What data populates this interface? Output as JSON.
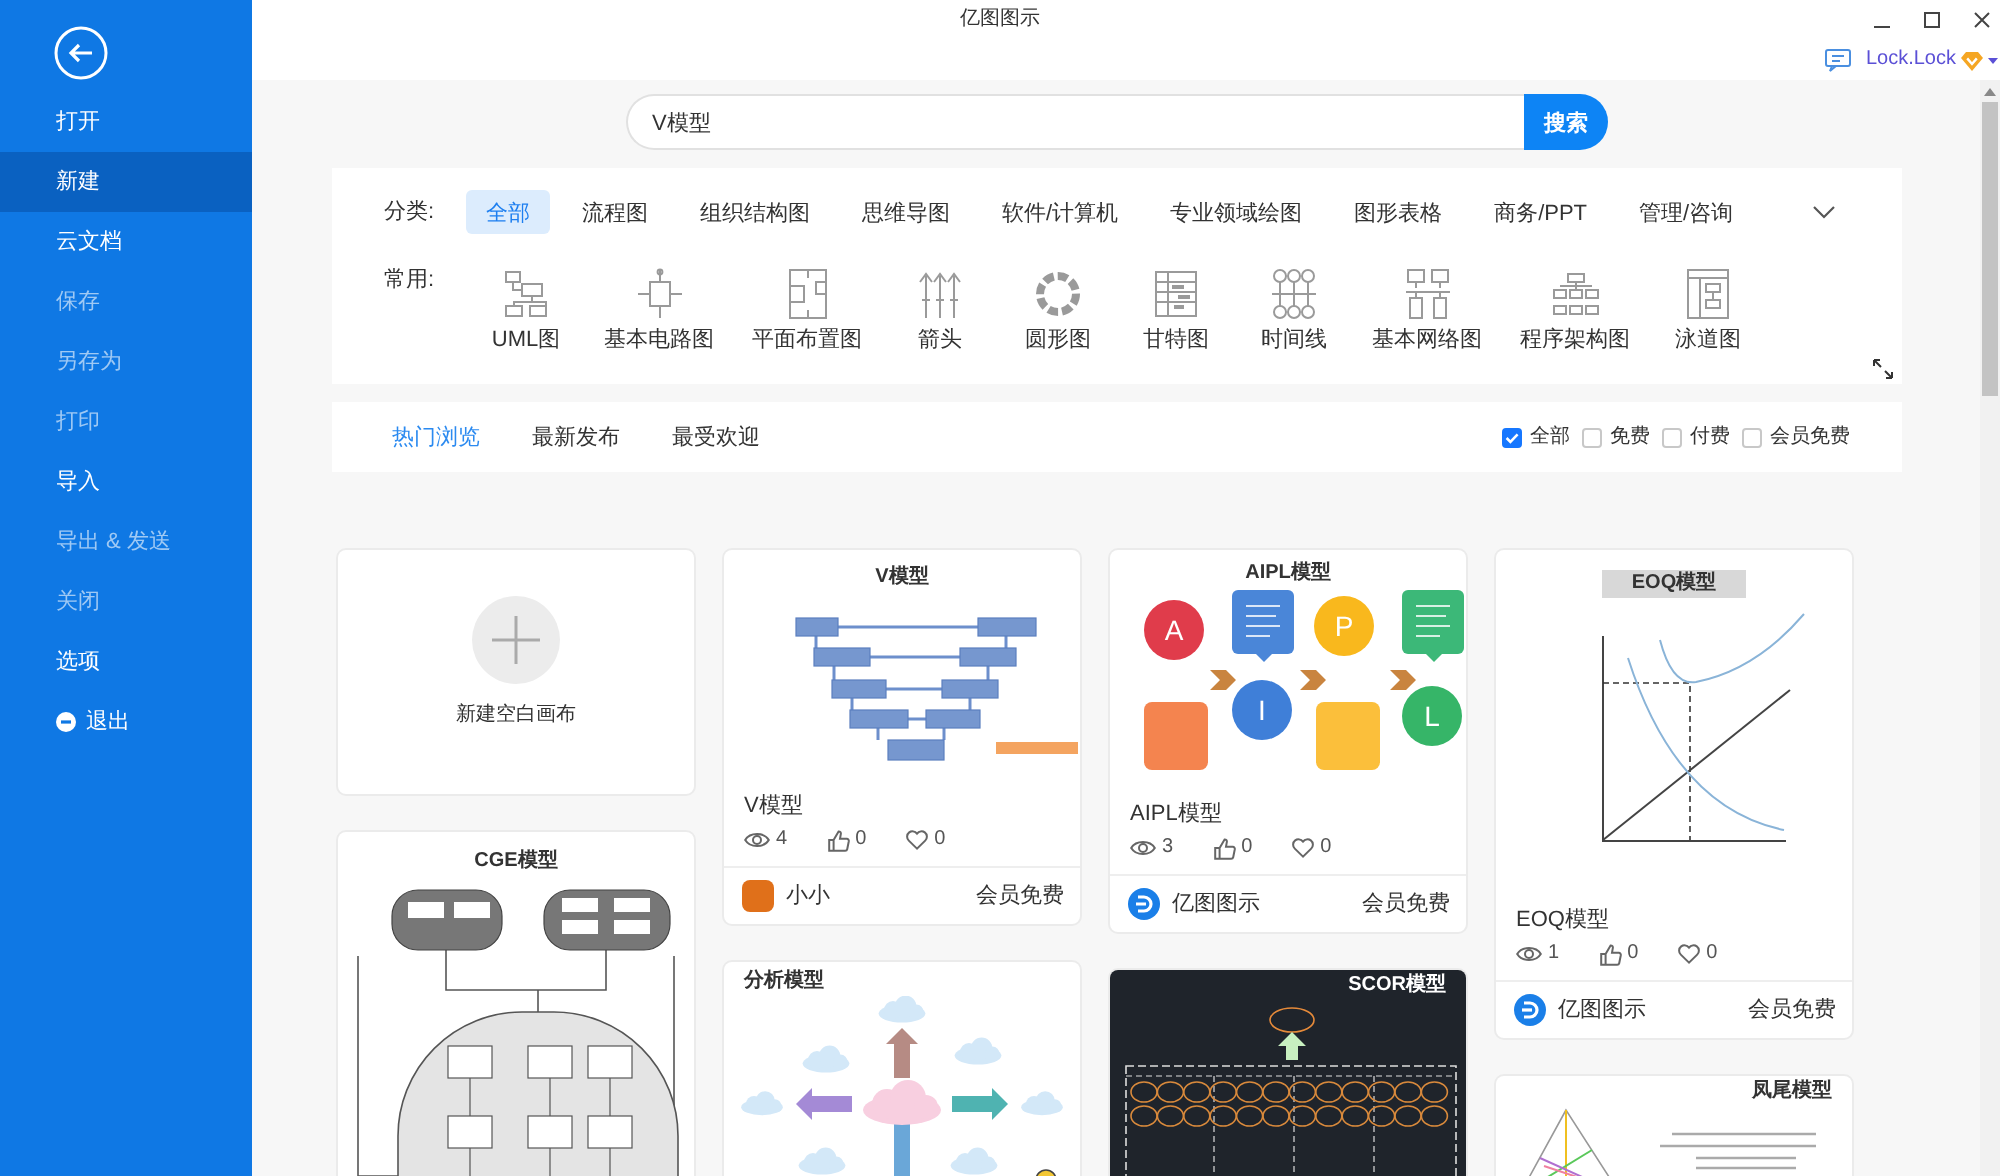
{
  "window": {
    "title": "亿图图示"
  },
  "account": {
    "username": "Lock.Lock"
  },
  "sidebar": {
    "items": [
      {
        "label": "打开",
        "kind": "plain",
        "selected": false,
        "disabled": false
      },
      {
        "label": "新建",
        "kind": "plain",
        "selected": true,
        "disabled": false
      },
      {
        "label": "云文档",
        "kind": "plain",
        "selected": false,
        "disabled": false
      },
      {
        "label": "保存",
        "kind": "plain",
        "selected": false,
        "disabled": true
      },
      {
        "label": "另存为",
        "kind": "plain",
        "selected": false,
        "disabled": true
      },
      {
        "label": "打印",
        "kind": "plain",
        "selected": false,
        "disabled": true
      },
      {
        "label": "导入",
        "kind": "plain",
        "selected": false,
        "disabled": false
      },
      {
        "label": "导出 & 发送",
        "kind": "plain",
        "selected": false,
        "disabled": true
      },
      {
        "label": "关闭",
        "kind": "plain",
        "selected": false,
        "disabled": true
      },
      {
        "label": "选项",
        "kind": "plain",
        "selected": false,
        "disabled": false
      },
      {
        "label": "退出",
        "kind": "exit",
        "selected": false,
        "disabled": false
      }
    ]
  },
  "search": {
    "value": "V模型",
    "button": "搜索"
  },
  "categories": {
    "label": "分类:",
    "items": [
      {
        "label": "全部",
        "selected": true
      },
      {
        "label": "流程图",
        "selected": false
      },
      {
        "label": "组织结构图",
        "selected": false
      },
      {
        "label": "思维导图",
        "selected": false
      },
      {
        "label": "软件/计算机",
        "selected": false
      },
      {
        "label": "专业领域绘图",
        "selected": false
      },
      {
        "label": "图形表格",
        "selected": false
      },
      {
        "label": "商务/PPT",
        "selected": false
      },
      {
        "label": "管理/咨询",
        "selected": false
      }
    ]
  },
  "common": {
    "label": "常用:",
    "items": [
      {
        "label": "UML图",
        "kind": "uml"
      },
      {
        "label": "基本电路图",
        "kind": "circuit"
      },
      {
        "label": "平面布置图",
        "kind": "floorplan"
      },
      {
        "label": "箭头",
        "kind": "arrows"
      },
      {
        "label": "圆形图",
        "kind": "ring"
      },
      {
        "label": "甘特图",
        "kind": "gantt"
      },
      {
        "label": "时间线",
        "kind": "timeline"
      },
      {
        "label": "基本网络图",
        "kind": "network"
      },
      {
        "label": "程序架构图",
        "kind": "architecture"
      },
      {
        "label": "泳道图",
        "kind": "swimlane"
      }
    ]
  },
  "tabs": [
    {
      "label": "热门浏览",
      "selected": true
    },
    {
      "label": "最新发布",
      "selected": false
    },
    {
      "label": "最受欢迎",
      "selected": false
    }
  ],
  "filters": [
    {
      "label": "全部",
      "checked": true
    },
    {
      "label": "免费",
      "checked": false
    },
    {
      "label": "付费",
      "checked": false
    },
    {
      "label": "会员免费",
      "checked": false
    }
  ],
  "columns": [
    [
      {
        "kind": "new",
        "label": "新建空白画布"
      },
      {
        "kind": "template",
        "preview": {
          "kind": "cge",
          "title": "CGE模型"
        }
      }
    ],
    [
      {
        "kind": "template",
        "preview": {
          "kind": "v",
          "title": "V模型"
        },
        "title": "V模型",
        "views": "4",
        "likes": "0",
        "favorites": "0",
        "author": {
          "name": "小小",
          "kind": "photo"
        },
        "price": "会员免费"
      },
      {
        "kind": "template",
        "preview": {
          "kind": "analysis",
          "title": "分析模型"
        }
      }
    ],
    [
      {
        "kind": "template",
        "preview": {
          "kind": "aipl",
          "title": "AIPL模型",
          "letters": [
            "A",
            "I",
            "P",
            "L"
          ]
        },
        "title": "AIPL模型",
        "views": "3",
        "likes": "0",
        "favorites": "0",
        "author": {
          "name": "亿图图示",
          "kind": "logo"
        },
        "price": "会员免费"
      },
      {
        "kind": "template",
        "preview": {
          "kind": "scor",
          "title": "SCOR模型"
        }
      }
    ],
    [
      {
        "kind": "template",
        "preview": {
          "kind": "eoq",
          "title": "EOQ模型"
        },
        "title": "EOQ模型",
        "views": "1",
        "likes": "0",
        "favorites": "0",
        "author": {
          "name": "亿图图示",
          "kind": "logo"
        },
        "price": "会员免费"
      },
      {
        "kind": "template",
        "preview": {
          "kind": "triangle",
          "title": "凤尾模型"
        }
      }
    ]
  ]
}
